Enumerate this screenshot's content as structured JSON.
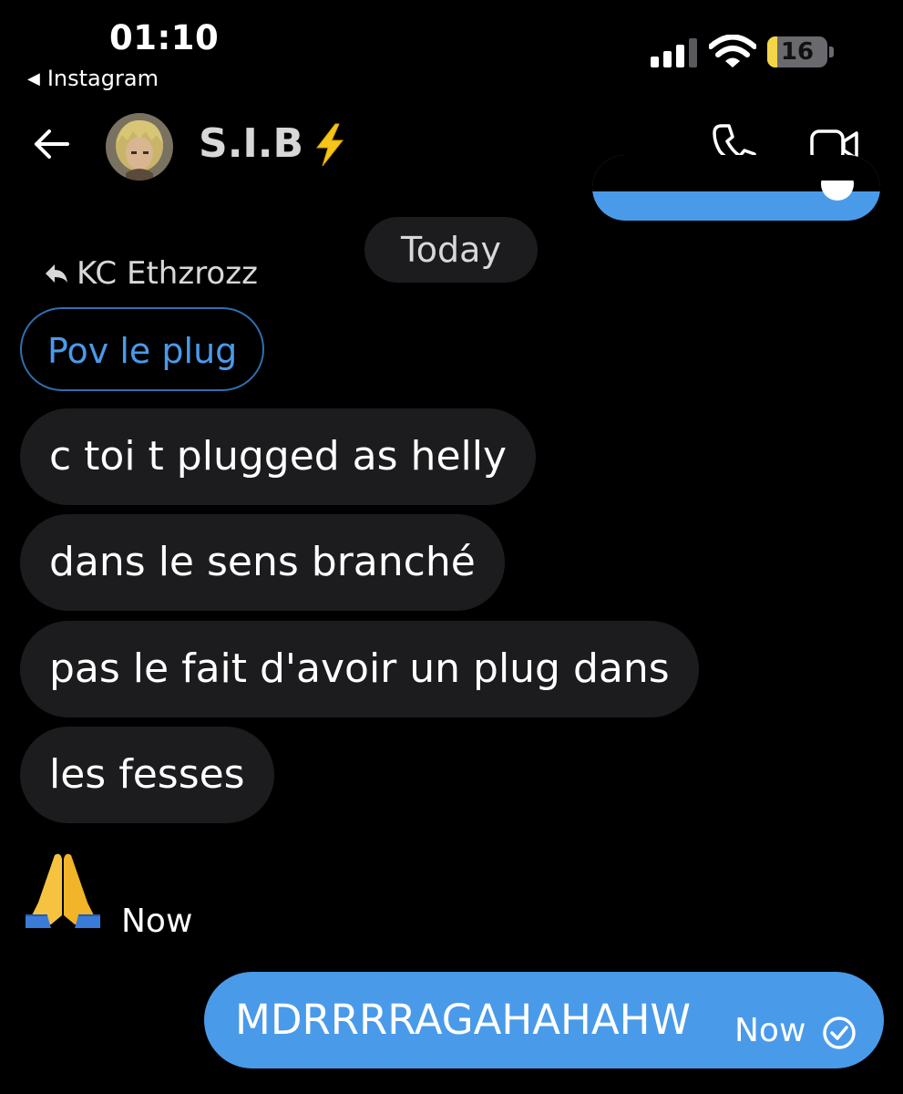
{
  "status_bar": {
    "time": "01:10",
    "back_app": "Instagram",
    "battery_level": "16",
    "battery_fraction": 0.16
  },
  "header": {
    "contact_name": "S.I.B"
  },
  "date_separator": "Today",
  "reply": {
    "to_user": "KC Ethzrozz",
    "quoted_text": "Pov le plug"
  },
  "messages": [
    {
      "text": "c toi t plugged as helly"
    },
    {
      "text": "dans le sens branché"
    },
    {
      "text": "pas le fait d'avoir un plug dans"
    },
    {
      "text": "les fesses"
    }
  ],
  "emoji_message": {
    "emoji": "folded-hands-emoji",
    "timestamp": "Now"
  },
  "outgoing": {
    "text": "MDRRRRAGAHAHAHW",
    "timestamp": "Now"
  },
  "colors": {
    "background": "#000000",
    "incoming_bubble": "#1c1c1e",
    "outgoing_bubble": "#4a9aea",
    "quoted_border": "#2f6fb3",
    "quoted_text": "#4a9aea",
    "bolt": "#f5c518",
    "battery_fill": "#f3d54a"
  }
}
